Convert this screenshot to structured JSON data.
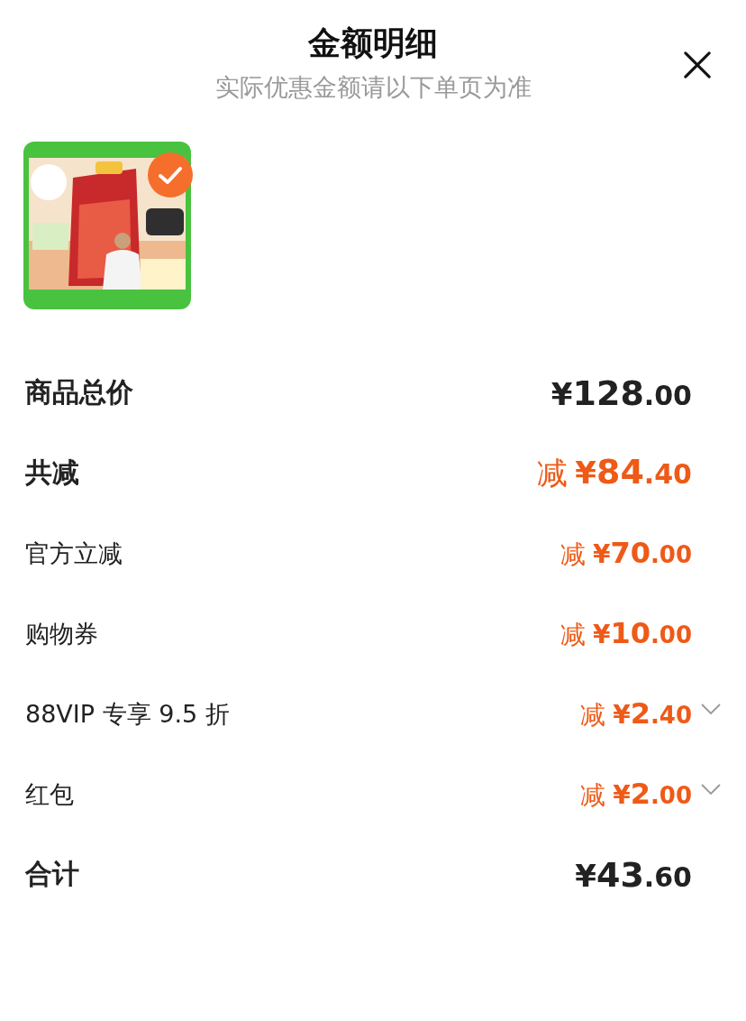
{
  "header": {
    "title": "金额明细",
    "subtitle": "实际优惠金额请以下单页为准"
  },
  "product": {
    "selected": true
  },
  "rows": [
    {
      "kind": "subtotal",
      "label": "商品总价",
      "prefix": "",
      "currency": "¥",
      "integer": "128",
      "decimal": ".00",
      "expandable": false
    },
    {
      "kind": "discount_sum",
      "label": "共减",
      "prefix": "减",
      "currency": "¥",
      "integer": "84",
      "decimal": ".40",
      "expandable": false
    },
    {
      "kind": "discount",
      "label": "官方立减",
      "prefix": "减",
      "currency": "¥",
      "integer": "70",
      "decimal": ".00",
      "expandable": false
    },
    {
      "kind": "discount",
      "label": "购物券",
      "prefix": "减",
      "currency": "¥",
      "integer": "10",
      "decimal": ".00",
      "expandable": false
    },
    {
      "kind": "discount",
      "label": "88VIP 专享 9.5 折",
      "prefix": "减",
      "currency": "¥",
      "integer": "2",
      "decimal": ".40",
      "expandable": true
    },
    {
      "kind": "discount",
      "label": "红包",
      "prefix": "减",
      "currency": "¥",
      "integer": "2",
      "decimal": ".00",
      "expandable": true
    },
    {
      "kind": "subtotal",
      "label": "合计",
      "prefix": "",
      "currency": "¥",
      "integer": "43",
      "decimal": ".60",
      "expandable": false
    }
  ]
}
